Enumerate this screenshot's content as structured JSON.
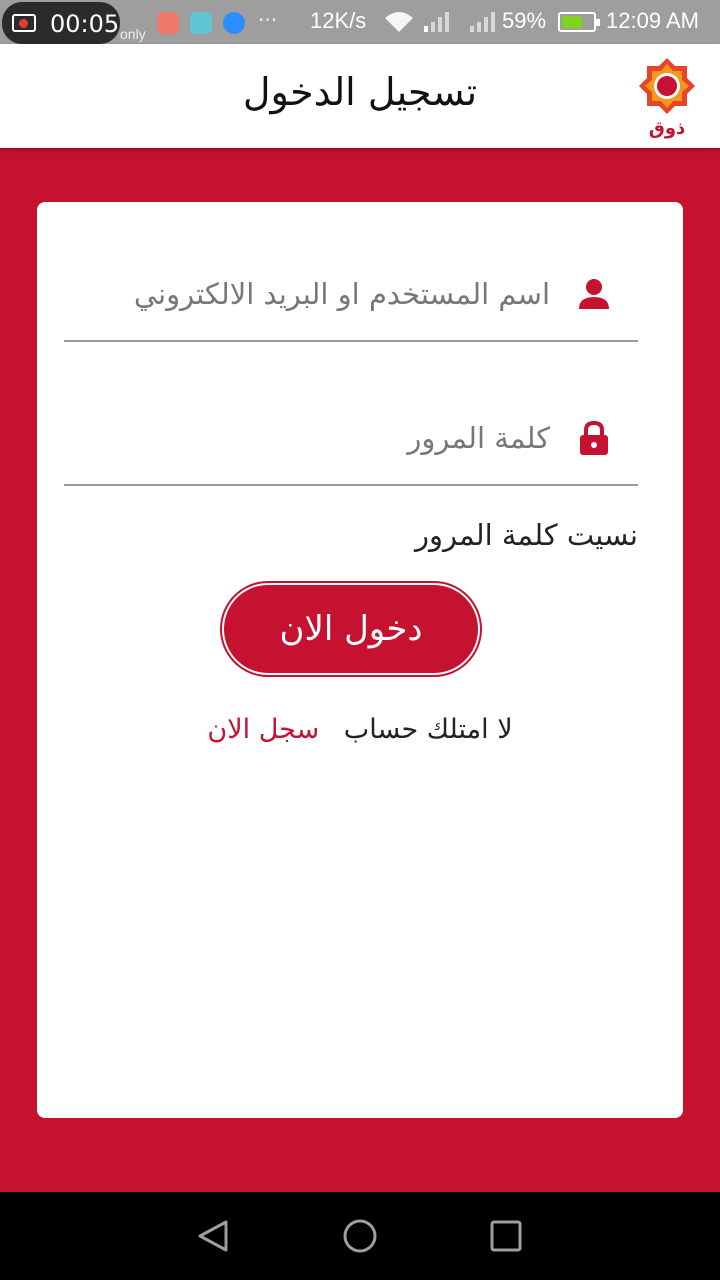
{
  "status_bar": {
    "record_time": "00:05",
    "carrier": "only",
    "speed": "12K/s",
    "battery": "59%",
    "time": "12:09 AM"
  },
  "app_bar": {
    "title": "تسجيل الدخول",
    "logo_text": "ذوق"
  },
  "form": {
    "username_placeholder": "اسم المستخدم او البريد الالكتروني",
    "username_value": "",
    "password_placeholder": "كلمة المرور",
    "password_value": "",
    "forgot_password": "نسيت كلمة المرور",
    "login_button": "دخول الان",
    "no_account": "لا امتلك حساب",
    "register_link": "سجل الان"
  },
  "colors": {
    "brand_red": "#c41230",
    "card_bg": "#ffffff"
  },
  "icons": {
    "username": "user-icon",
    "password": "lock-icon",
    "nav_back": "back-triangle-icon",
    "nav_home": "home-circle-icon",
    "nav_recent": "recent-square-icon"
  }
}
